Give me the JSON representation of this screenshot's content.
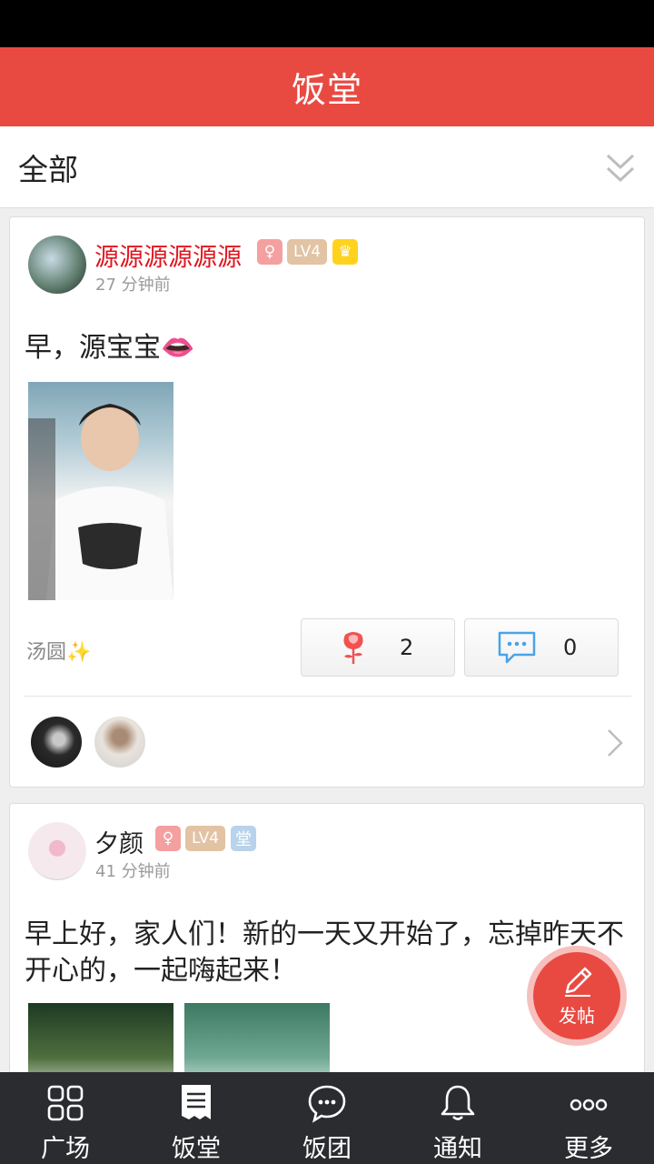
{
  "header": {
    "title": "饭堂"
  },
  "filter": {
    "label": "全部"
  },
  "posts": [
    {
      "user": "源源源源源源",
      "time": "27 分钟前",
      "badges": {
        "gender": "♀",
        "level": "LV4",
        "crown": "♛"
      },
      "text": "早，源宝宝👄",
      "reward": "汤圆✨",
      "likes": "2",
      "comments": "0"
    },
    {
      "user": "夕颜",
      "time": "41 分钟前",
      "badges": {
        "gender": "♀",
        "level": "LV4",
        "tang": "堂"
      },
      "text": "早上好，家人们！新的一天又开始了，忘掉昨天不开心的，一起嗨起来！"
    }
  ],
  "fab": {
    "label": "发帖"
  },
  "tabs": [
    {
      "label": "广场",
      "icon": "grid-icon"
    },
    {
      "label": "饭堂",
      "icon": "document-icon"
    },
    {
      "label": "饭团",
      "icon": "chat-bubble-icon"
    },
    {
      "label": "通知",
      "icon": "bell-icon"
    },
    {
      "label": "更多",
      "icon": "more-dots-icon"
    }
  ],
  "colors": {
    "brand": "#e84a42",
    "tabbar": "#2b2c30",
    "username_red": "#e0151f"
  }
}
